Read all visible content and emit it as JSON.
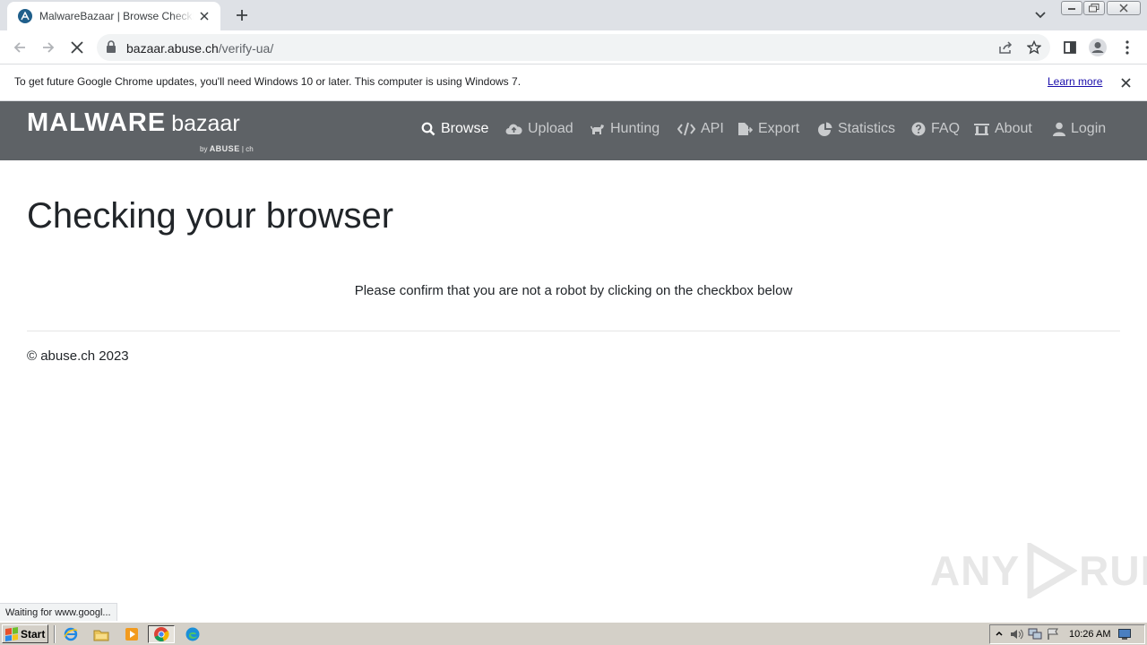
{
  "browser": {
    "tab_title": "MalwareBazaar | Browse Checking your browser",
    "url_host": "bazaar.abuse.ch",
    "url_path": "/verify-ua/",
    "infobar_text": "To get future Google Chrome updates, you'll need Windows 10 or later. This computer is using Windows 7.",
    "infobar_link": "Learn more",
    "status_text": "Waiting for www.googl..."
  },
  "site": {
    "brand_main": "MALWARE",
    "brand_sub": "bazaar",
    "brand_by": "by",
    "brand_org": "ABUSE",
    "brand_tld": "ch",
    "nav": [
      {
        "label": "Browse",
        "icon": "search-icon",
        "active": true
      },
      {
        "label": "Upload",
        "icon": "cloud-upload-icon"
      },
      {
        "label": "Hunting",
        "icon": "dog-icon"
      },
      {
        "label": "API",
        "icon": "code-icon"
      },
      {
        "label": "Export",
        "icon": "file-export-icon"
      },
      {
        "label": "Statistics",
        "icon": "pie-chart-icon"
      },
      {
        "label": "FAQ",
        "icon": "question-icon"
      },
      {
        "label": "About",
        "icon": "landmark-icon"
      },
      {
        "label": "Login",
        "icon": "user-icon"
      }
    ]
  },
  "page": {
    "heading": "Checking your browser",
    "confirm_text": "Please confirm that you are not a robot by clicking on the checkbox below",
    "copyright": "© abuse.ch 2023"
  },
  "watermark": {
    "left": "ANY",
    "right": "RUN"
  },
  "taskbar": {
    "start_label": "Start",
    "clock": "10:26 AM"
  },
  "colors": {
    "navbar_bg": "#5e6266",
    "tabstrip_bg": "#dee1e6",
    "link": "#1a0dab",
    "taskbar_bg": "#d4d0c8"
  }
}
